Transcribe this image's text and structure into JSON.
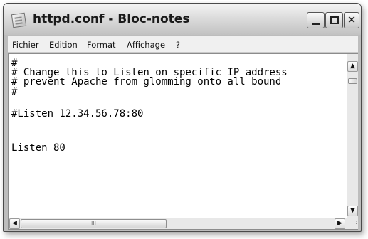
{
  "window": {
    "title": "httpd.conf - Bloc-notes",
    "minimize_label": "_",
    "close_label": "✕"
  },
  "menu": [
    "Fichier",
    "Edition",
    "Format",
    "Affichage",
    "?"
  ],
  "document": {
    "lines": [
      "#",
      "# Change this to Listen on specific IP address",
      "# prevent Apache from glomming onto all bound",
      "#",
      "#Listen 12.34.56.78:80",
      "",
      "",
      "",
      "Listen 80"
    ]
  },
  "scrollbars": {
    "up_arrow": "▲",
    "down_arrow": "▼",
    "left_arrow": "◀",
    "right_arrow": "▶",
    "h_thumb_grip": "III",
    "resize_grip": ".:"
  }
}
